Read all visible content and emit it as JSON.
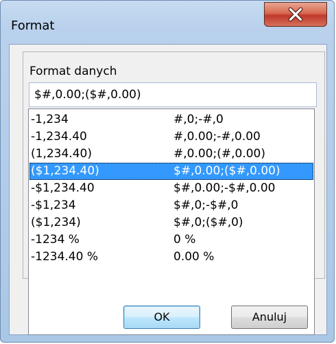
{
  "window": {
    "title": "Format"
  },
  "group": {
    "label": "Format danych"
  },
  "format_input": {
    "value": "$#,0.00;($#,0.00)"
  },
  "list": {
    "rows": [
      {
        "example": "-1,234",
        "format": "#,0;-#,0",
        "selected": false
      },
      {
        "example": "-1,234.40",
        "format": "#,0.00;-#,0.00",
        "selected": false
      },
      {
        "example": "(1,234.40)",
        "format": "#,0.00;(#,0.00)",
        "selected": false
      },
      {
        "example": "($1,234.40)",
        "format": "$#,0.00;($#,0.00)",
        "selected": true
      },
      {
        "example": "-$1,234.40",
        "format": "$#,0.00;-$#,0.00",
        "selected": false
      },
      {
        "example": "-$1,234",
        "format": "$#,0;-$#,0",
        "selected": false
      },
      {
        "example": "($1,234)",
        "format": "$#,0;($#,0)",
        "selected": false
      },
      {
        "example": "-1234 %",
        "format": "0 %",
        "selected": false
      },
      {
        "example": "-1234.40 %",
        "format": "0.00 %",
        "selected": false
      }
    ]
  },
  "buttons": {
    "ok_label": "OK",
    "cancel_label": "Anuluj"
  },
  "icons": {
    "close": "close-icon"
  },
  "colors": {
    "selection": "#3399ff",
    "close_button": "#c0392b"
  }
}
